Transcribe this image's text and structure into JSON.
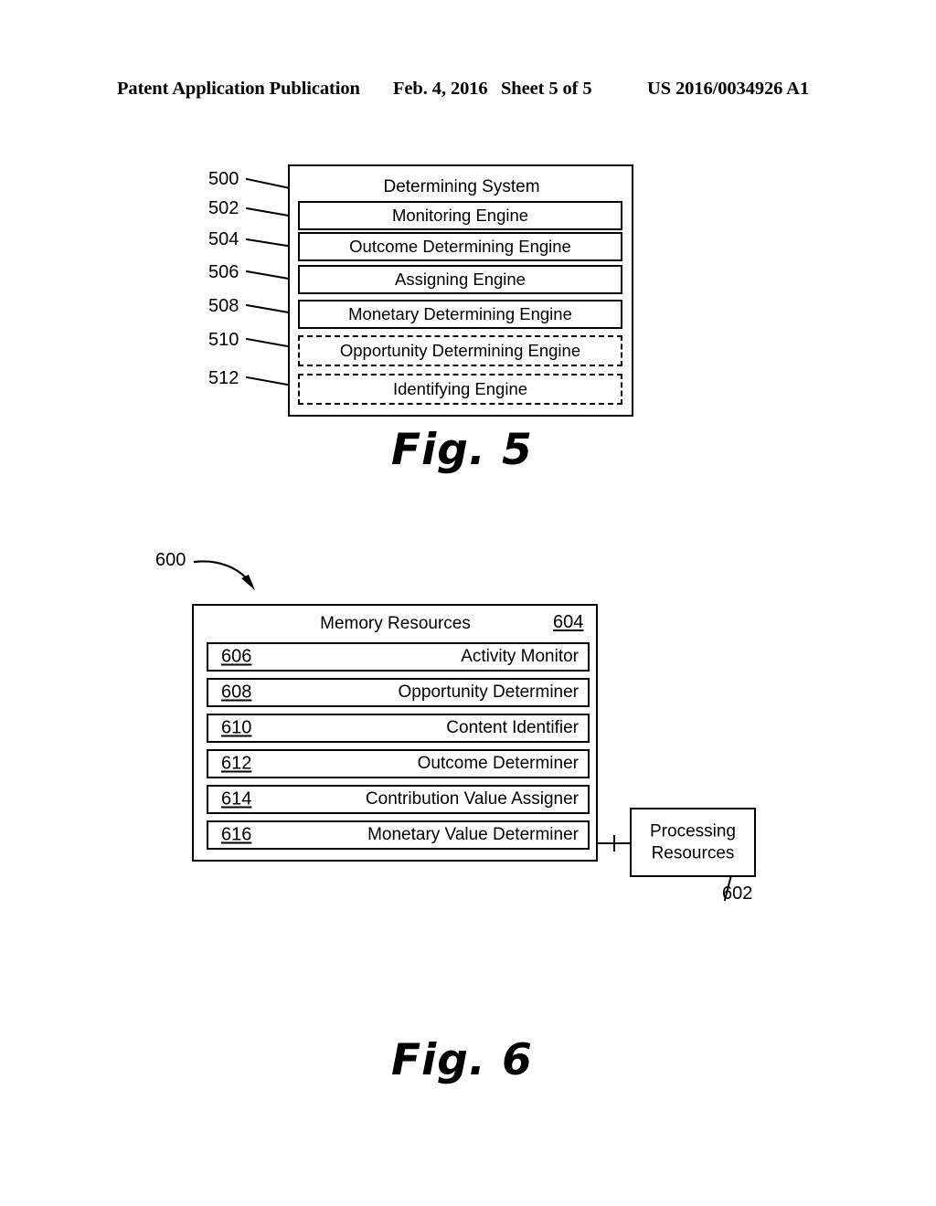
{
  "header": {
    "publication": "Patent Application Publication",
    "date": "Feb. 4, 2016",
    "sheet": "Sheet 5 of 5",
    "patent_number": "US 2016/0034926 A1"
  },
  "figure5": {
    "caption": "Fig. 5",
    "system_ref": "500",
    "system_title": "Determining System",
    "engines": [
      {
        "ref": "502",
        "label": "Monitoring Engine",
        "style": "solid"
      },
      {
        "ref": "504",
        "label": "Outcome Determining Engine",
        "style": "solid"
      },
      {
        "ref": "506",
        "label": "Assigning Engine",
        "style": "solid"
      },
      {
        "ref": "508",
        "label": "Monetary Determining Engine",
        "style": "solid"
      },
      {
        "ref": "510",
        "label": "Opportunity Determining Engine",
        "style": "dashed"
      },
      {
        "ref": "512",
        "label": "Identifying Engine",
        "style": "dashed"
      }
    ]
  },
  "figure6": {
    "caption": "Fig. 6",
    "system_ref": "600",
    "memory": {
      "ref": "604",
      "title": "Memory Resources",
      "modules": [
        {
          "ref": "606",
          "label": "Activity Monitor"
        },
        {
          "ref": "608",
          "label": "Opportunity Determiner"
        },
        {
          "ref": "610",
          "label": "Content Identifier"
        },
        {
          "ref": "612",
          "label": "Outcome Determiner"
        },
        {
          "ref": "614",
          "label": "Contribution Value Assigner"
        },
        {
          "ref": "616",
          "label": "Monetary Value Determiner"
        }
      ]
    },
    "processing": {
      "ref": "602",
      "line1": "Processing",
      "line2": "Resources"
    }
  }
}
